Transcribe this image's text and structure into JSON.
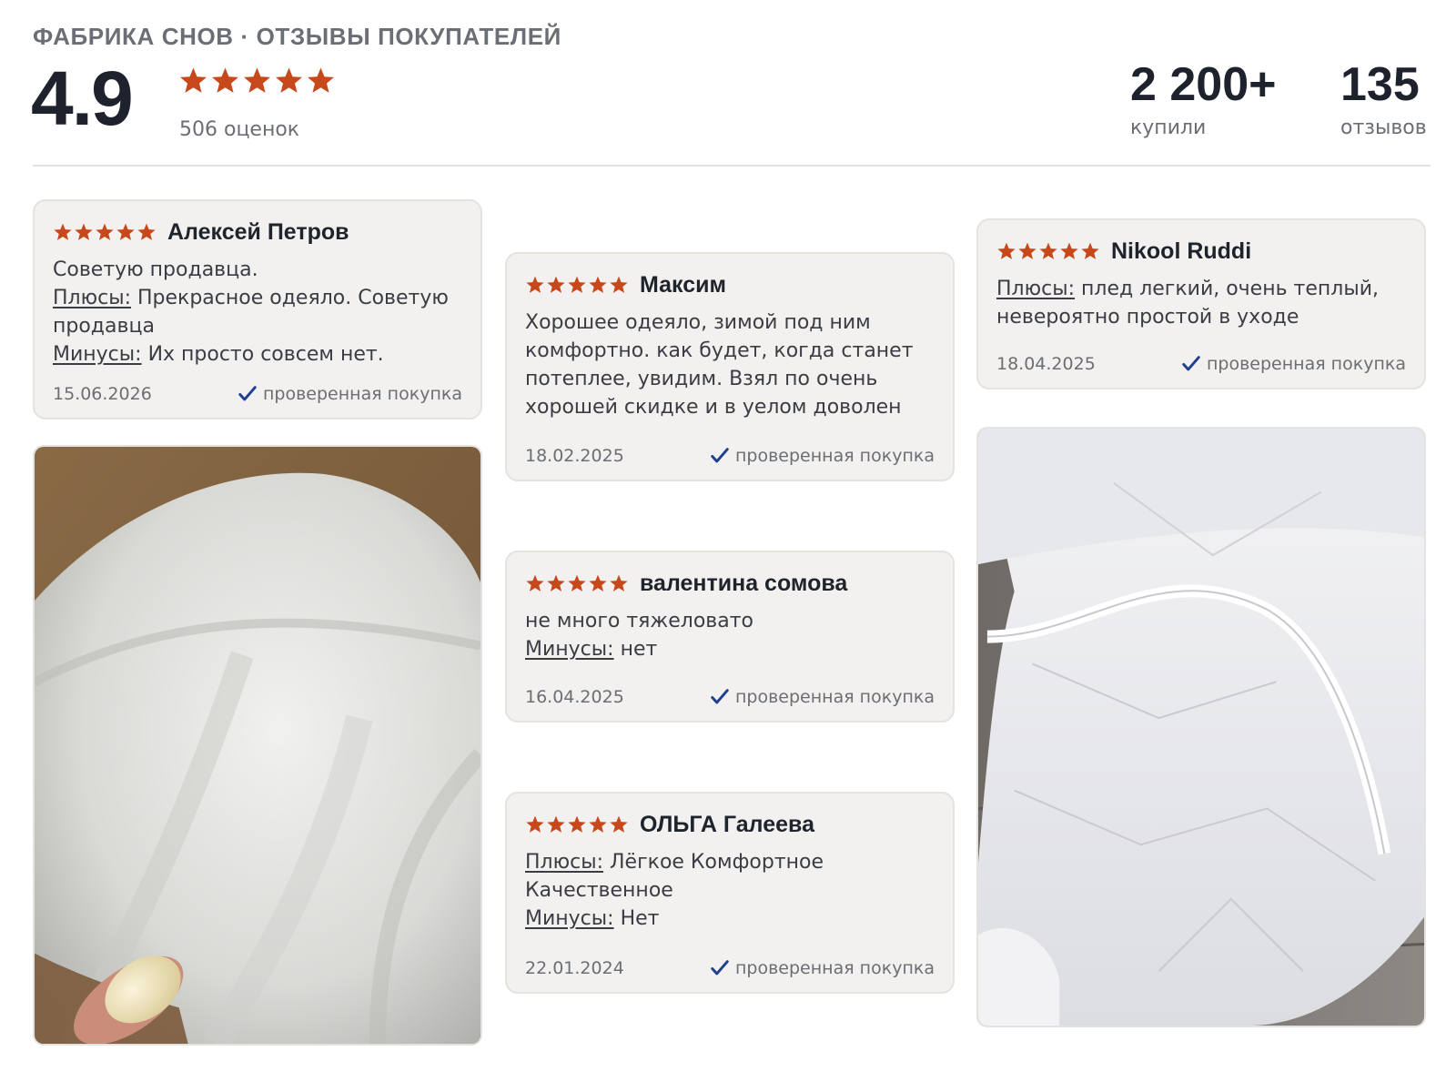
{
  "header": {
    "brand": "ФАБРИКА СНОВ · ОТЗЫВЫ ПОКУПАТЕЛЕЙ",
    "score": "4.9",
    "rating_count": "506 оценок",
    "bought_value": "2 200+",
    "bought_label": "купили",
    "reviews_value": "135",
    "reviews_label": "отзывов",
    "stars": 5
  },
  "labels": {
    "pros": "Плюсы:",
    "cons": "Минусы:",
    "verified": "проверенная покупка"
  },
  "reviews": [
    {
      "author": "Алексей Петров",
      "stars": 5,
      "text": "Советую продавца.",
      "pros": "Прекрасное одеяло. Советую продавца",
      "cons": "Их просто совсем нет.",
      "date": "15.06.2026"
    },
    {
      "author": "Максим",
      "stars": 5,
      "text": "Хорошее одеяло, зимой под ним комфортно. как будет, когда станет потеплее, увидим. Взял по очень хорошей скидке и в уелом доволен",
      "date": "18.02.2025"
    },
    {
      "author": "валентина сомова",
      "stars": 5,
      "text": "не много тяжеловато",
      "cons": "нет",
      "date": "16.04.2025"
    },
    {
      "author": "ОЛЬГА Галеева",
      "stars": 5,
      "pros": "Лёгкое Комфортное Качественное",
      "cons": "Нет",
      "date": "22.01.2024"
    },
    {
      "author": "Nikool Ruddi",
      "stars": 5,
      "pros": "плед легкий, очень теплый, невероятно простой в уходе",
      "date": "18.04.2025"
    }
  ],
  "colors": {
    "star": "#c6481b",
    "check": "#1f3f8f",
    "card_bg": "#f2f1ef",
    "text_dark": "#1f232c",
    "text_muted": "#6b6e74"
  },
  "icons": {
    "star": "star-icon",
    "check": "check-icon"
  }
}
